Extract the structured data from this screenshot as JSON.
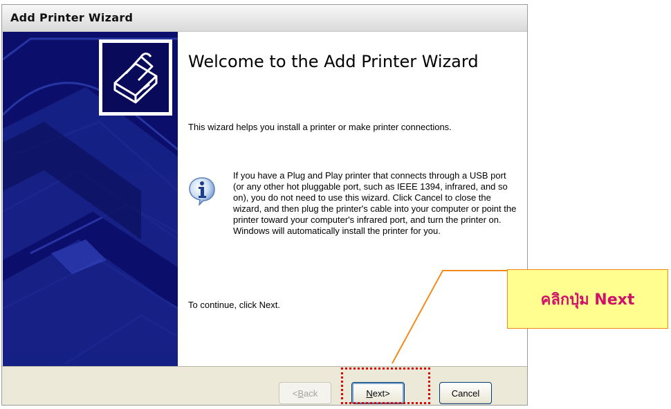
{
  "window": {
    "title": "Add Printer Wizard"
  },
  "content": {
    "heading": "Welcome to the Add Printer Wizard",
    "intro": "This wizard helps you install a printer or make printer connections.",
    "info_text": "If you have a Plug and Play printer that connects through a USB port (or any other hot pluggable port, such as IEEE 1394, infrared, and so on), you do not need to use this wizard. Click Cancel to close the wizard, and then plug the printer's cable into your computer or point the printer toward your computer's infrared port, and turn the printer on. Windows will automatically install the printer for you.",
    "continue_text": "To continue, click Next.",
    "info_icon": "info-icon",
    "printer_icon": "printer-icon"
  },
  "buttons": {
    "back_accel": "B",
    "back_rest": "ack",
    "back_prefix": "< ",
    "next_accel": "N",
    "next_rest": "ext",
    "next_suffix": " >",
    "cancel": "Cancel"
  },
  "annotation": {
    "callout_text": "คลิกปุ่ม Next",
    "callout_color": "#fffe8f",
    "highlight_color": "#e00000",
    "leader_color": "#f28a1a"
  },
  "colors": {
    "sidebar": "#0b0f6b",
    "footer": "#ece9d8"
  }
}
